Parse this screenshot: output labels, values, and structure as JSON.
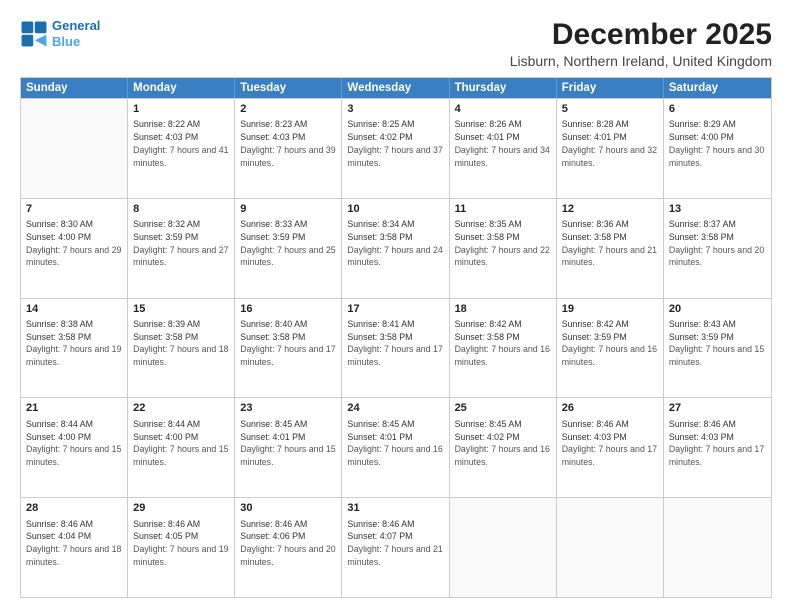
{
  "logo": {
    "line1": "General",
    "line2": "Blue"
  },
  "title": "December 2025",
  "subtitle": "Lisburn, Northern Ireland, United Kingdom",
  "days_of_week": [
    "Sunday",
    "Monday",
    "Tuesday",
    "Wednesday",
    "Thursday",
    "Friday",
    "Saturday"
  ],
  "weeks": [
    [
      {
        "num": "",
        "sunrise": "",
        "sunset": "",
        "daylight": ""
      },
      {
        "num": "1",
        "sunrise": "Sunrise: 8:22 AM",
        "sunset": "Sunset: 4:03 PM",
        "daylight": "Daylight: 7 hours and 41 minutes."
      },
      {
        "num": "2",
        "sunrise": "Sunrise: 8:23 AM",
        "sunset": "Sunset: 4:03 PM",
        "daylight": "Daylight: 7 hours and 39 minutes."
      },
      {
        "num": "3",
        "sunrise": "Sunrise: 8:25 AM",
        "sunset": "Sunset: 4:02 PM",
        "daylight": "Daylight: 7 hours and 37 minutes."
      },
      {
        "num": "4",
        "sunrise": "Sunrise: 8:26 AM",
        "sunset": "Sunset: 4:01 PM",
        "daylight": "Daylight: 7 hours and 34 minutes."
      },
      {
        "num": "5",
        "sunrise": "Sunrise: 8:28 AM",
        "sunset": "Sunset: 4:01 PM",
        "daylight": "Daylight: 7 hours and 32 minutes."
      },
      {
        "num": "6",
        "sunrise": "Sunrise: 8:29 AM",
        "sunset": "Sunset: 4:00 PM",
        "daylight": "Daylight: 7 hours and 30 minutes."
      }
    ],
    [
      {
        "num": "7",
        "sunrise": "Sunrise: 8:30 AM",
        "sunset": "Sunset: 4:00 PM",
        "daylight": "Daylight: 7 hours and 29 minutes."
      },
      {
        "num": "8",
        "sunrise": "Sunrise: 8:32 AM",
        "sunset": "Sunset: 3:59 PM",
        "daylight": "Daylight: 7 hours and 27 minutes."
      },
      {
        "num": "9",
        "sunrise": "Sunrise: 8:33 AM",
        "sunset": "Sunset: 3:59 PM",
        "daylight": "Daylight: 7 hours and 25 minutes."
      },
      {
        "num": "10",
        "sunrise": "Sunrise: 8:34 AM",
        "sunset": "Sunset: 3:58 PM",
        "daylight": "Daylight: 7 hours and 24 minutes."
      },
      {
        "num": "11",
        "sunrise": "Sunrise: 8:35 AM",
        "sunset": "Sunset: 3:58 PM",
        "daylight": "Daylight: 7 hours and 22 minutes."
      },
      {
        "num": "12",
        "sunrise": "Sunrise: 8:36 AM",
        "sunset": "Sunset: 3:58 PM",
        "daylight": "Daylight: 7 hours and 21 minutes."
      },
      {
        "num": "13",
        "sunrise": "Sunrise: 8:37 AM",
        "sunset": "Sunset: 3:58 PM",
        "daylight": "Daylight: 7 hours and 20 minutes."
      }
    ],
    [
      {
        "num": "14",
        "sunrise": "Sunrise: 8:38 AM",
        "sunset": "Sunset: 3:58 PM",
        "daylight": "Daylight: 7 hours and 19 minutes."
      },
      {
        "num": "15",
        "sunrise": "Sunrise: 8:39 AM",
        "sunset": "Sunset: 3:58 PM",
        "daylight": "Daylight: 7 hours and 18 minutes."
      },
      {
        "num": "16",
        "sunrise": "Sunrise: 8:40 AM",
        "sunset": "Sunset: 3:58 PM",
        "daylight": "Daylight: 7 hours and 17 minutes."
      },
      {
        "num": "17",
        "sunrise": "Sunrise: 8:41 AM",
        "sunset": "Sunset: 3:58 PM",
        "daylight": "Daylight: 7 hours and 17 minutes."
      },
      {
        "num": "18",
        "sunrise": "Sunrise: 8:42 AM",
        "sunset": "Sunset: 3:58 PM",
        "daylight": "Daylight: 7 hours and 16 minutes."
      },
      {
        "num": "19",
        "sunrise": "Sunrise: 8:42 AM",
        "sunset": "Sunset: 3:59 PM",
        "daylight": "Daylight: 7 hours and 16 minutes."
      },
      {
        "num": "20",
        "sunrise": "Sunrise: 8:43 AM",
        "sunset": "Sunset: 3:59 PM",
        "daylight": "Daylight: 7 hours and 15 minutes."
      }
    ],
    [
      {
        "num": "21",
        "sunrise": "Sunrise: 8:44 AM",
        "sunset": "Sunset: 4:00 PM",
        "daylight": "Daylight: 7 hours and 15 minutes."
      },
      {
        "num": "22",
        "sunrise": "Sunrise: 8:44 AM",
        "sunset": "Sunset: 4:00 PM",
        "daylight": "Daylight: 7 hours and 15 minutes."
      },
      {
        "num": "23",
        "sunrise": "Sunrise: 8:45 AM",
        "sunset": "Sunset: 4:01 PM",
        "daylight": "Daylight: 7 hours and 15 minutes."
      },
      {
        "num": "24",
        "sunrise": "Sunrise: 8:45 AM",
        "sunset": "Sunset: 4:01 PM",
        "daylight": "Daylight: 7 hours and 16 minutes."
      },
      {
        "num": "25",
        "sunrise": "Sunrise: 8:45 AM",
        "sunset": "Sunset: 4:02 PM",
        "daylight": "Daylight: 7 hours and 16 minutes."
      },
      {
        "num": "26",
        "sunrise": "Sunrise: 8:46 AM",
        "sunset": "Sunset: 4:03 PM",
        "daylight": "Daylight: 7 hours and 17 minutes."
      },
      {
        "num": "27",
        "sunrise": "Sunrise: 8:46 AM",
        "sunset": "Sunset: 4:03 PM",
        "daylight": "Daylight: 7 hours and 17 minutes."
      }
    ],
    [
      {
        "num": "28",
        "sunrise": "Sunrise: 8:46 AM",
        "sunset": "Sunset: 4:04 PM",
        "daylight": "Daylight: 7 hours and 18 minutes."
      },
      {
        "num": "29",
        "sunrise": "Sunrise: 8:46 AM",
        "sunset": "Sunset: 4:05 PM",
        "daylight": "Daylight: 7 hours and 19 minutes."
      },
      {
        "num": "30",
        "sunrise": "Sunrise: 8:46 AM",
        "sunset": "Sunset: 4:06 PM",
        "daylight": "Daylight: 7 hours and 20 minutes."
      },
      {
        "num": "31",
        "sunrise": "Sunrise: 8:46 AM",
        "sunset": "Sunset: 4:07 PM",
        "daylight": "Daylight: 7 hours and 21 minutes."
      },
      {
        "num": "",
        "sunrise": "",
        "sunset": "",
        "daylight": ""
      },
      {
        "num": "",
        "sunrise": "",
        "sunset": "",
        "daylight": ""
      },
      {
        "num": "",
        "sunrise": "",
        "sunset": "",
        "daylight": ""
      }
    ]
  ]
}
